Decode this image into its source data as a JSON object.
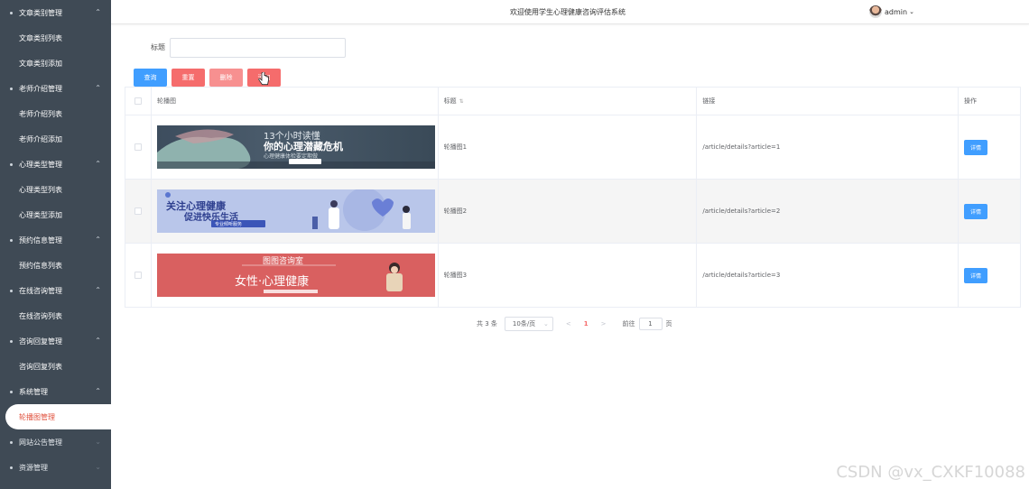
{
  "header": {
    "title": "欢迎使用学生心理健康咨询评估系统",
    "username": "admin"
  },
  "sidebar": {
    "items": [
      {
        "type": "group",
        "label": "文章类别管理",
        "arrow": "^"
      },
      {
        "type": "sub",
        "label": "文章类别列表"
      },
      {
        "type": "sub",
        "label": "文章类别添加"
      },
      {
        "type": "group",
        "label": "老师介绍管理",
        "arrow": "^"
      },
      {
        "type": "sub",
        "label": "老师介绍列表"
      },
      {
        "type": "sub",
        "label": "老师介绍添加"
      },
      {
        "type": "group",
        "label": "心理类型管理",
        "arrow": "^"
      },
      {
        "type": "sub",
        "label": "心理类型列表"
      },
      {
        "type": "sub",
        "label": "心理类型添加"
      },
      {
        "type": "group",
        "label": "预约信息管理",
        "arrow": "^"
      },
      {
        "type": "sub",
        "label": "预约信息列表"
      },
      {
        "type": "group",
        "label": "在线咨询管理",
        "arrow": "^"
      },
      {
        "type": "sub",
        "label": "在线咨询列表"
      },
      {
        "type": "group",
        "label": "咨询回复管理",
        "arrow": "^"
      },
      {
        "type": "sub",
        "label": "咨询回复列表"
      },
      {
        "type": "group",
        "label": "系统管理",
        "arrow": "^"
      },
      {
        "type": "sub",
        "label": "轮播图管理",
        "active": true
      },
      {
        "type": "group",
        "label": "网站公告管理",
        "arrow": "v",
        "dim": true
      },
      {
        "type": "group",
        "label": "资源管理",
        "arrow": "v",
        "dim": true
      }
    ]
  },
  "search": {
    "label": "标题",
    "value": ""
  },
  "buttons": {
    "query": "查询",
    "reset": "重置",
    "delete": "删除",
    "add": "添加"
  },
  "table": {
    "headers": [
      "",
      "轮播图",
      "标题",
      "链接",
      "操作"
    ],
    "rows": [
      {
        "title": "轮播图1",
        "link": "/article/details?article=1",
        "action": "详情",
        "banner_texts": [
          "13个小时读懂",
          "你的心理潜藏危机",
          "心理健康体检要定期做"
        ]
      },
      {
        "title": "轮播图2",
        "link": "/article/details?article=2",
        "action": "详情",
        "banner_texts": [
          "关注心理健康",
          "促进快乐生活",
          "专业倾听服务"
        ]
      },
      {
        "title": "轮播图3",
        "link": "/article/details?article=3",
        "action": "详情",
        "banner_texts": [
          "图图咨询室",
          "女性·心理健康"
        ]
      }
    ]
  },
  "pagination": {
    "total": "共 3 条",
    "page_size": "10条/页",
    "prev": "<",
    "current": "1",
    "next": ">",
    "goto_label": "前往",
    "goto_value": "1",
    "page_unit": "页"
  },
  "watermark": "CSDN @vx_CXKF10088",
  "colors": {
    "sidebar_bg": "#3f4a55",
    "primary": "#409eff",
    "danger": "#f56c6c",
    "active_text": "#e0503c"
  }
}
